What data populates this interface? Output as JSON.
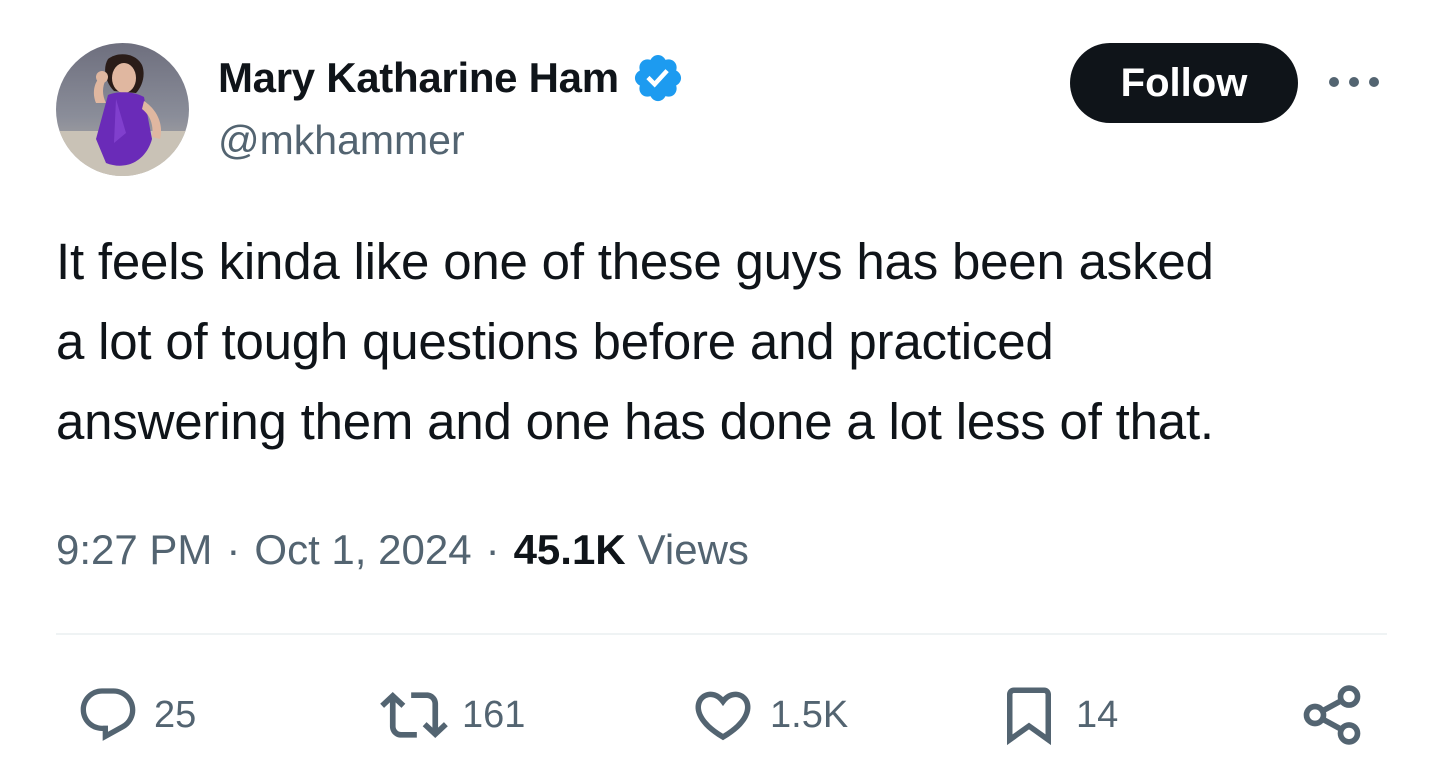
{
  "author": {
    "display_name": "Mary Katharine Ham",
    "handle": "@mkhammer",
    "verified": true
  },
  "follow_label": "Follow",
  "tweet": {
    "lines": [
      "It feels kinda like one of these guys has been asked",
      "a lot of tough questions before and practiced",
      "answering them and one has done a lot less of that."
    ]
  },
  "meta": {
    "time": "9:27 PM",
    "separator": "·",
    "date": "Oct 1, 2024",
    "views_count": "45.1K",
    "views_label": "Views"
  },
  "actions": {
    "replies": "25",
    "reposts": "161",
    "likes": "1.5K",
    "bookmarks": "14"
  },
  "icons": {
    "verified": "verified-badge-icon",
    "more": "more-dots-icon",
    "reply": "reply-bubble-icon",
    "repost": "repost-icon",
    "like": "heart-icon",
    "bookmark": "bookmark-icon",
    "share": "share-icon"
  },
  "colors": {
    "text_primary": "#0f1419",
    "text_secondary": "#536471",
    "verified_blue": "#1d9bf0",
    "follow_bg": "#0f1419",
    "divider": "#eff3f4"
  }
}
